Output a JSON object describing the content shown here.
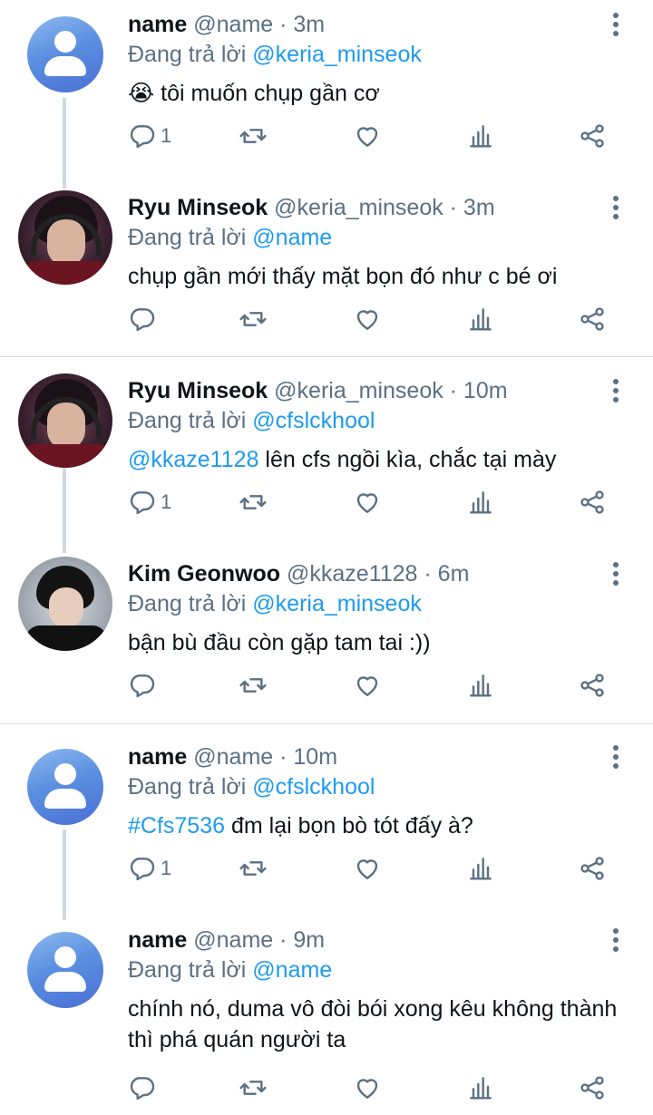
{
  "reply_prefix": "Đang trả lời",
  "tweets": [
    {
      "name": "name",
      "meta": "@name · 3m",
      "replying_to": "@keria_minseok",
      "emoji": "😭",
      "text": "tôi muốn chụp gần cơ",
      "reply_count": "1"
    },
    {
      "name": "Ryu Minseok",
      "meta": "@keria_minseok · 3m",
      "replying_to": "@name",
      "text": "chụp gần mới thấy mặt bọn đó như c bé ơi",
      "reply_count": ""
    },
    {
      "name": "Ryu Minseok",
      "meta": "@keria_minseok · 10m",
      "replying_to": "@cfslckhool",
      "mention_lead": "@kkaze1128",
      "text": "lên cfs ngồi kìa, chắc tại mày",
      "reply_count": "1"
    },
    {
      "name": "Kim Geonwoo",
      "meta": "@kkaze1128 · 6m",
      "replying_to": "@keria_minseok",
      "text": "bận bù đầu còn gặp tam tai :))",
      "reply_count": ""
    },
    {
      "name": "name",
      "meta": "@name · 10m",
      "replying_to": "@cfslckhool",
      "mention_lead": "#Cfs7536",
      "text": "đm lại bọn bò tót đấy à?",
      "reply_count": "1"
    },
    {
      "name": "name",
      "meta": "@name · 9m",
      "replying_to": "@name",
      "text": "chính nó, duma vô đòi bói xong kêu không thành thì phá quán người ta",
      "reply_count": ""
    }
  ],
  "icons": {
    "reply": "reply-icon",
    "retweet": "retweet-icon",
    "like": "heart-icon",
    "stats": "stats-icon",
    "share": "share-icon",
    "more": "more-icon"
  },
  "colors": {
    "link": "#1d9bf0",
    "muted": "#5b7083",
    "text": "#0f1419"
  }
}
